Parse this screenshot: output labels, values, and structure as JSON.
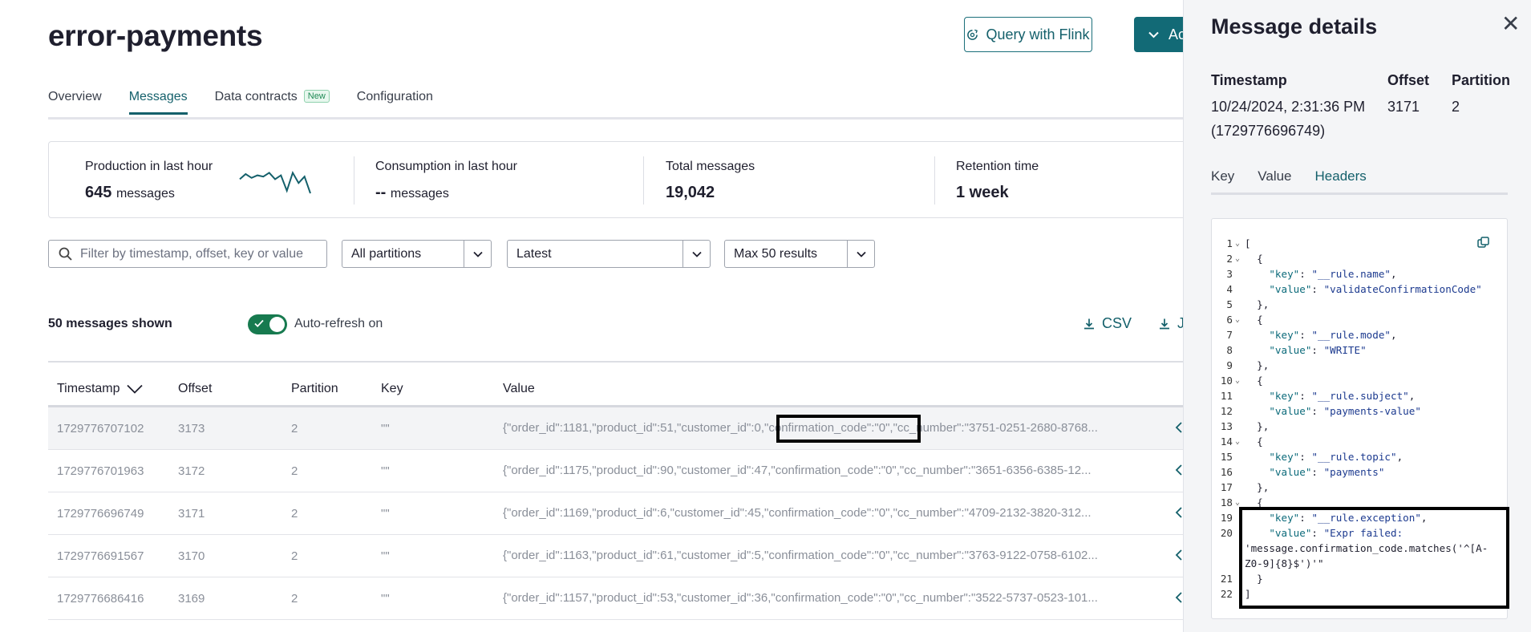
{
  "header": {
    "topic_name": "error-payments",
    "query_flink_label": "Query with Flink",
    "actions_label": "Ac"
  },
  "tabs": [
    {
      "label": "Overview",
      "active": false
    },
    {
      "label": "Messages",
      "active": true
    },
    {
      "label": "Data contracts",
      "badge": "New",
      "active": false
    },
    {
      "label": "Configuration",
      "active": false
    }
  ],
  "stats": [
    {
      "label": "Production in last hour",
      "value": "645",
      "unit": "messages",
      "sparkline": [
        0.55,
        0.75,
        0.6,
        0.7,
        0.65,
        0.8,
        0.55,
        0.7,
        0.1,
        0.8,
        0.4,
        0.65,
        0.0
      ]
    },
    {
      "label": "Consumption in last hour",
      "value": "--",
      "unit": "messages"
    },
    {
      "label": "Total messages",
      "value": "19,042",
      "unit": ""
    },
    {
      "label": "Retention time",
      "value": "1 week",
      "unit": ""
    }
  ],
  "filters": {
    "search_placeholder": "Filter by timestamp, offset, key or value",
    "partitions": "All partitions",
    "position": "Latest",
    "max_results": "Max 50 results"
  },
  "list_bar": {
    "messages_shown": "50 messages shown",
    "auto_refresh": "Auto-refresh on",
    "auto_refresh_on": true,
    "download_csv": "CSV",
    "download_json": "J"
  },
  "table": {
    "columns": [
      "Timestamp",
      "Offset",
      "Partition",
      "Key",
      "Value"
    ],
    "rows": [
      {
        "timestamp": "1729776707102",
        "offset": "3173",
        "partition": "2",
        "key": "\"\"",
        "value": "{\"order_id\":1181,\"product_id\":51,\"customer_id\":0,\"confirmation_code\":\"0\",\"cc_number\":\"3751-0251-2680-8768..."
      },
      {
        "timestamp": "1729776701963",
        "offset": "3172",
        "partition": "2",
        "key": "\"\"",
        "value": "{\"order_id\":1175,\"product_id\":90,\"customer_id\":47,\"confirmation_code\":\"0\",\"cc_number\":\"3651-6356-6385-12..."
      },
      {
        "timestamp": "1729776696749",
        "offset": "3171",
        "partition": "2",
        "key": "\"\"",
        "value": "{\"order_id\":1169,\"product_id\":6,\"customer_id\":45,\"confirmation_code\":\"0\",\"cc_number\":\"4709-2132-3820-312..."
      },
      {
        "timestamp": "1729776691567",
        "offset": "3170",
        "partition": "2",
        "key": "\"\"",
        "value": "{\"order_id\":1163,\"product_id\":61,\"customer_id\":5,\"confirmation_code\":\"0\",\"cc_number\":\"3763-9122-0758-6102..."
      },
      {
        "timestamp": "1729776686416",
        "offset": "3169",
        "partition": "2",
        "key": "\"\"",
        "value": "{\"order_id\":1157,\"product_id\":53,\"customer_id\":36,\"confirmation_code\":\"0\",\"cc_number\":\"3522-5737-0523-101..."
      }
    ]
  },
  "panel": {
    "title": "Message details",
    "timestamp_label": "Timestamp",
    "timestamp_value": "10/24/2024, 2:31:36 PM",
    "timestamp_epoch": "(1729776696749)",
    "offset_label": "Offset",
    "offset_value": "3171",
    "partition_label": "Partition",
    "partition_value": "2",
    "tabs": [
      "Key",
      "Value",
      "Headers"
    ],
    "active_tab": "Headers",
    "code_lines": [
      {
        "n": "1",
        "fold": true,
        "text": "["
      },
      {
        "n": "2",
        "fold": true,
        "text": "  {"
      },
      {
        "n": "3",
        "fold": false,
        "text": "    \"key\": \"__rule.name\","
      },
      {
        "n": "4",
        "fold": false,
        "text": "    \"value\": \"validateConfirmationCode\""
      },
      {
        "n": "5",
        "fold": false,
        "text": "  },"
      },
      {
        "n": "6",
        "fold": true,
        "text": "  {"
      },
      {
        "n": "7",
        "fold": false,
        "text": "    \"key\": \"__rule.mode\","
      },
      {
        "n": "8",
        "fold": false,
        "text": "    \"value\": \"WRITE\""
      },
      {
        "n": "9",
        "fold": false,
        "text": "  },"
      },
      {
        "n": "10",
        "fold": true,
        "text": "  {"
      },
      {
        "n": "11",
        "fold": false,
        "text": "    \"key\": \"__rule.subject\","
      },
      {
        "n": "12",
        "fold": false,
        "text": "    \"value\": \"payments-value\""
      },
      {
        "n": "13",
        "fold": false,
        "text": "  },"
      },
      {
        "n": "14",
        "fold": true,
        "text": "  {"
      },
      {
        "n": "15",
        "fold": false,
        "text": "    \"key\": \"__rule.topic\","
      },
      {
        "n": "16",
        "fold": false,
        "text": "    \"value\": \"payments\""
      },
      {
        "n": "17",
        "fold": false,
        "text": "  },"
      },
      {
        "n": "18",
        "fold": true,
        "text": "  {"
      },
      {
        "n": "19",
        "fold": false,
        "text": "    \"key\": \"__rule.exception\","
      },
      {
        "n": "20",
        "fold": false,
        "text": "    \"value\": \"Expr failed:"
      },
      {
        "n": "",
        "fold": false,
        "text": "'message.confirmation_code.matches('^[A-"
      },
      {
        "n": "",
        "fold": false,
        "text": "Z0-9]{8}$')'\""
      },
      {
        "n": "21",
        "fold": false,
        "text": "  }"
      },
      {
        "n": "22",
        "fold": false,
        "text": "]"
      }
    ]
  },
  "colors": {
    "accent": "#14606b",
    "primary_button": "#126a76",
    "toggle_on": "#177a4f",
    "badge_green": "#1f8a55"
  }
}
